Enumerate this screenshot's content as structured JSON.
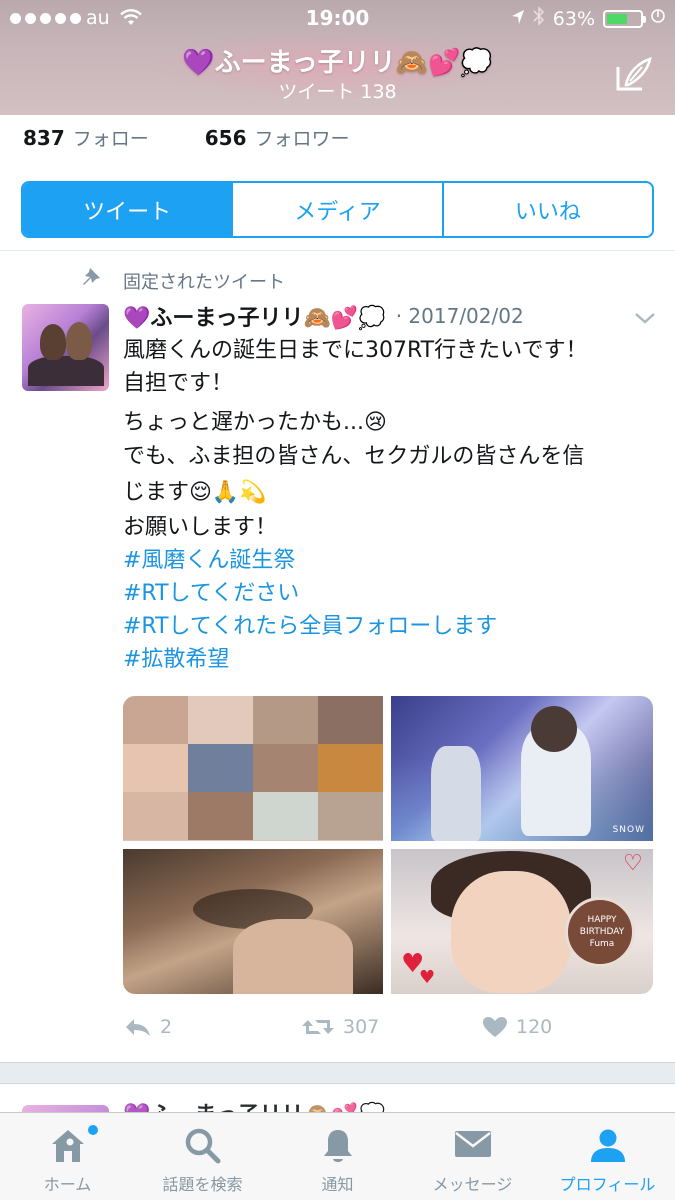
{
  "status_bar": {
    "carrier": "au",
    "time": "19:00",
    "battery": "63%",
    "battery_level": 0.63
  },
  "header": {
    "name": "💜ふーまっ子リリ🙈💕💭",
    "subtitle": "ツイート 138"
  },
  "counts": {
    "following_count": "837",
    "following_label": "フォロー",
    "followers_count": "656",
    "followers_label": "フォロワー"
  },
  "tabs": [
    {
      "label": "ツイート",
      "active": true
    },
    {
      "label": "メディア",
      "active": false
    },
    {
      "label": "いいね",
      "active": false
    }
  ],
  "tweet": {
    "pinned_label": "固定されたツイート",
    "name": "💜ふーまっ子リリ🙈💕💭",
    "date": "· 2017/02/02",
    "lines": [
      "風磨くんの誕生日までに307RT行きたいです！",
      "自担です！",
      "ちょっと遅かったかも...😢",
      "でも、ふま担の皆さん、セクガルの皆さんを信",
      "じます😌🙏💫",
      "お願いします！"
    ],
    "hashtags": [
      "#風磨くん誕生祭",
      "#RTしてください",
      "#RTしてくれたら全員フォローします",
      "#拡散希望"
    ],
    "reply_count": "2",
    "retweet_count": "307",
    "like_count": "120"
  },
  "media_overlay": {
    "snow_label": "SNOW",
    "cake_text": "HAPPY BIRTHDAY Fuma"
  },
  "next_tweet": {
    "name_peek": "💜ふーまっ子リリ🙈💕💭"
  },
  "tabbar": [
    {
      "label": "ホーム",
      "icon": "home-icon",
      "active": false
    },
    {
      "label": "話題を検索",
      "icon": "search-icon",
      "active": false
    },
    {
      "label": "通知",
      "icon": "bell-icon",
      "active": false
    },
    {
      "label": "メッセージ",
      "icon": "envelope-icon",
      "active": false
    },
    {
      "label": "プロフィール",
      "icon": "profile-icon",
      "active": true
    }
  ],
  "colors": {
    "accent": "#1da1f2",
    "hashtag": "#1b95e0",
    "muted": "#657786",
    "action": "#aab8c2"
  }
}
